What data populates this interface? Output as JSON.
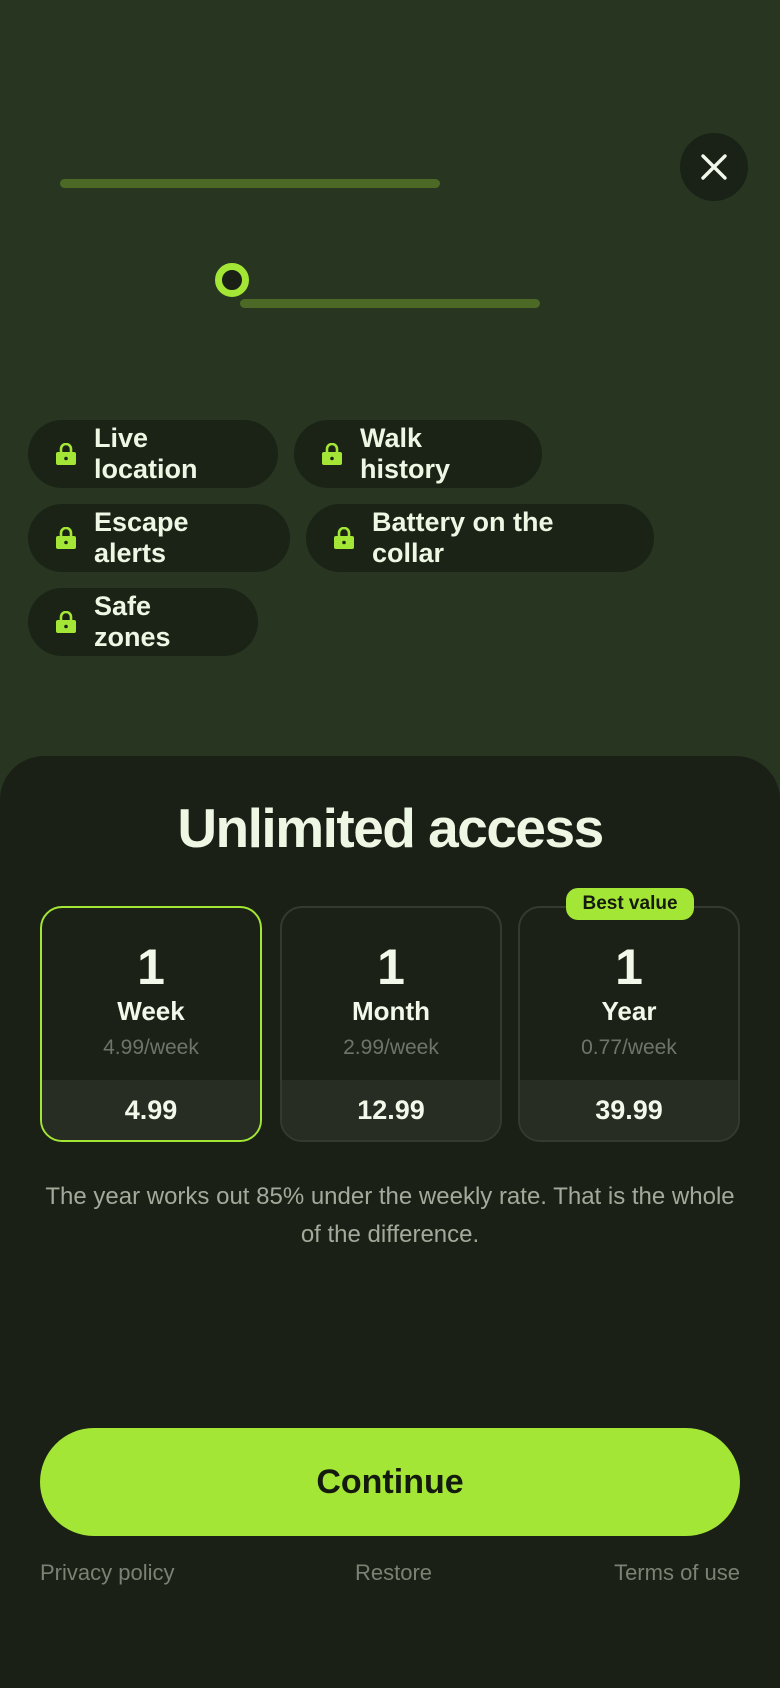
{
  "features": [
    {
      "label": "Live location",
      "icon": "lock-icon"
    },
    {
      "label": "Walk history",
      "icon": "lock-icon"
    },
    {
      "label": "Escape alerts",
      "icon": "lock-icon"
    },
    {
      "label": "Battery on the collar",
      "icon": "lock-icon"
    },
    {
      "label": "Safe zones",
      "icon": "lock-icon"
    }
  ],
  "sheet": {
    "title": "Unlimited access"
  },
  "plans": [
    {
      "count": "1",
      "period": "Week",
      "rate": "4.99/week",
      "price": "4.99",
      "selected": true
    },
    {
      "count": "1",
      "period": "Month",
      "rate": "2.99/week",
      "price": "12.99",
      "selected": false
    },
    {
      "count": "1",
      "period": "Year",
      "rate": "0.77/week",
      "price": "39.99",
      "selected": false,
      "badge": "Best value"
    }
  ],
  "note": "The year works out 85% under the weekly rate. That is the whole of the difference.",
  "cta": {
    "label": "Continue"
  },
  "footer": {
    "privacy": "Privacy policy",
    "restore": "Restore",
    "terms": "Terms of use"
  },
  "colors": {
    "accent": "#a3e635",
    "background": "#283621",
    "sheet": "#1a2015"
  }
}
